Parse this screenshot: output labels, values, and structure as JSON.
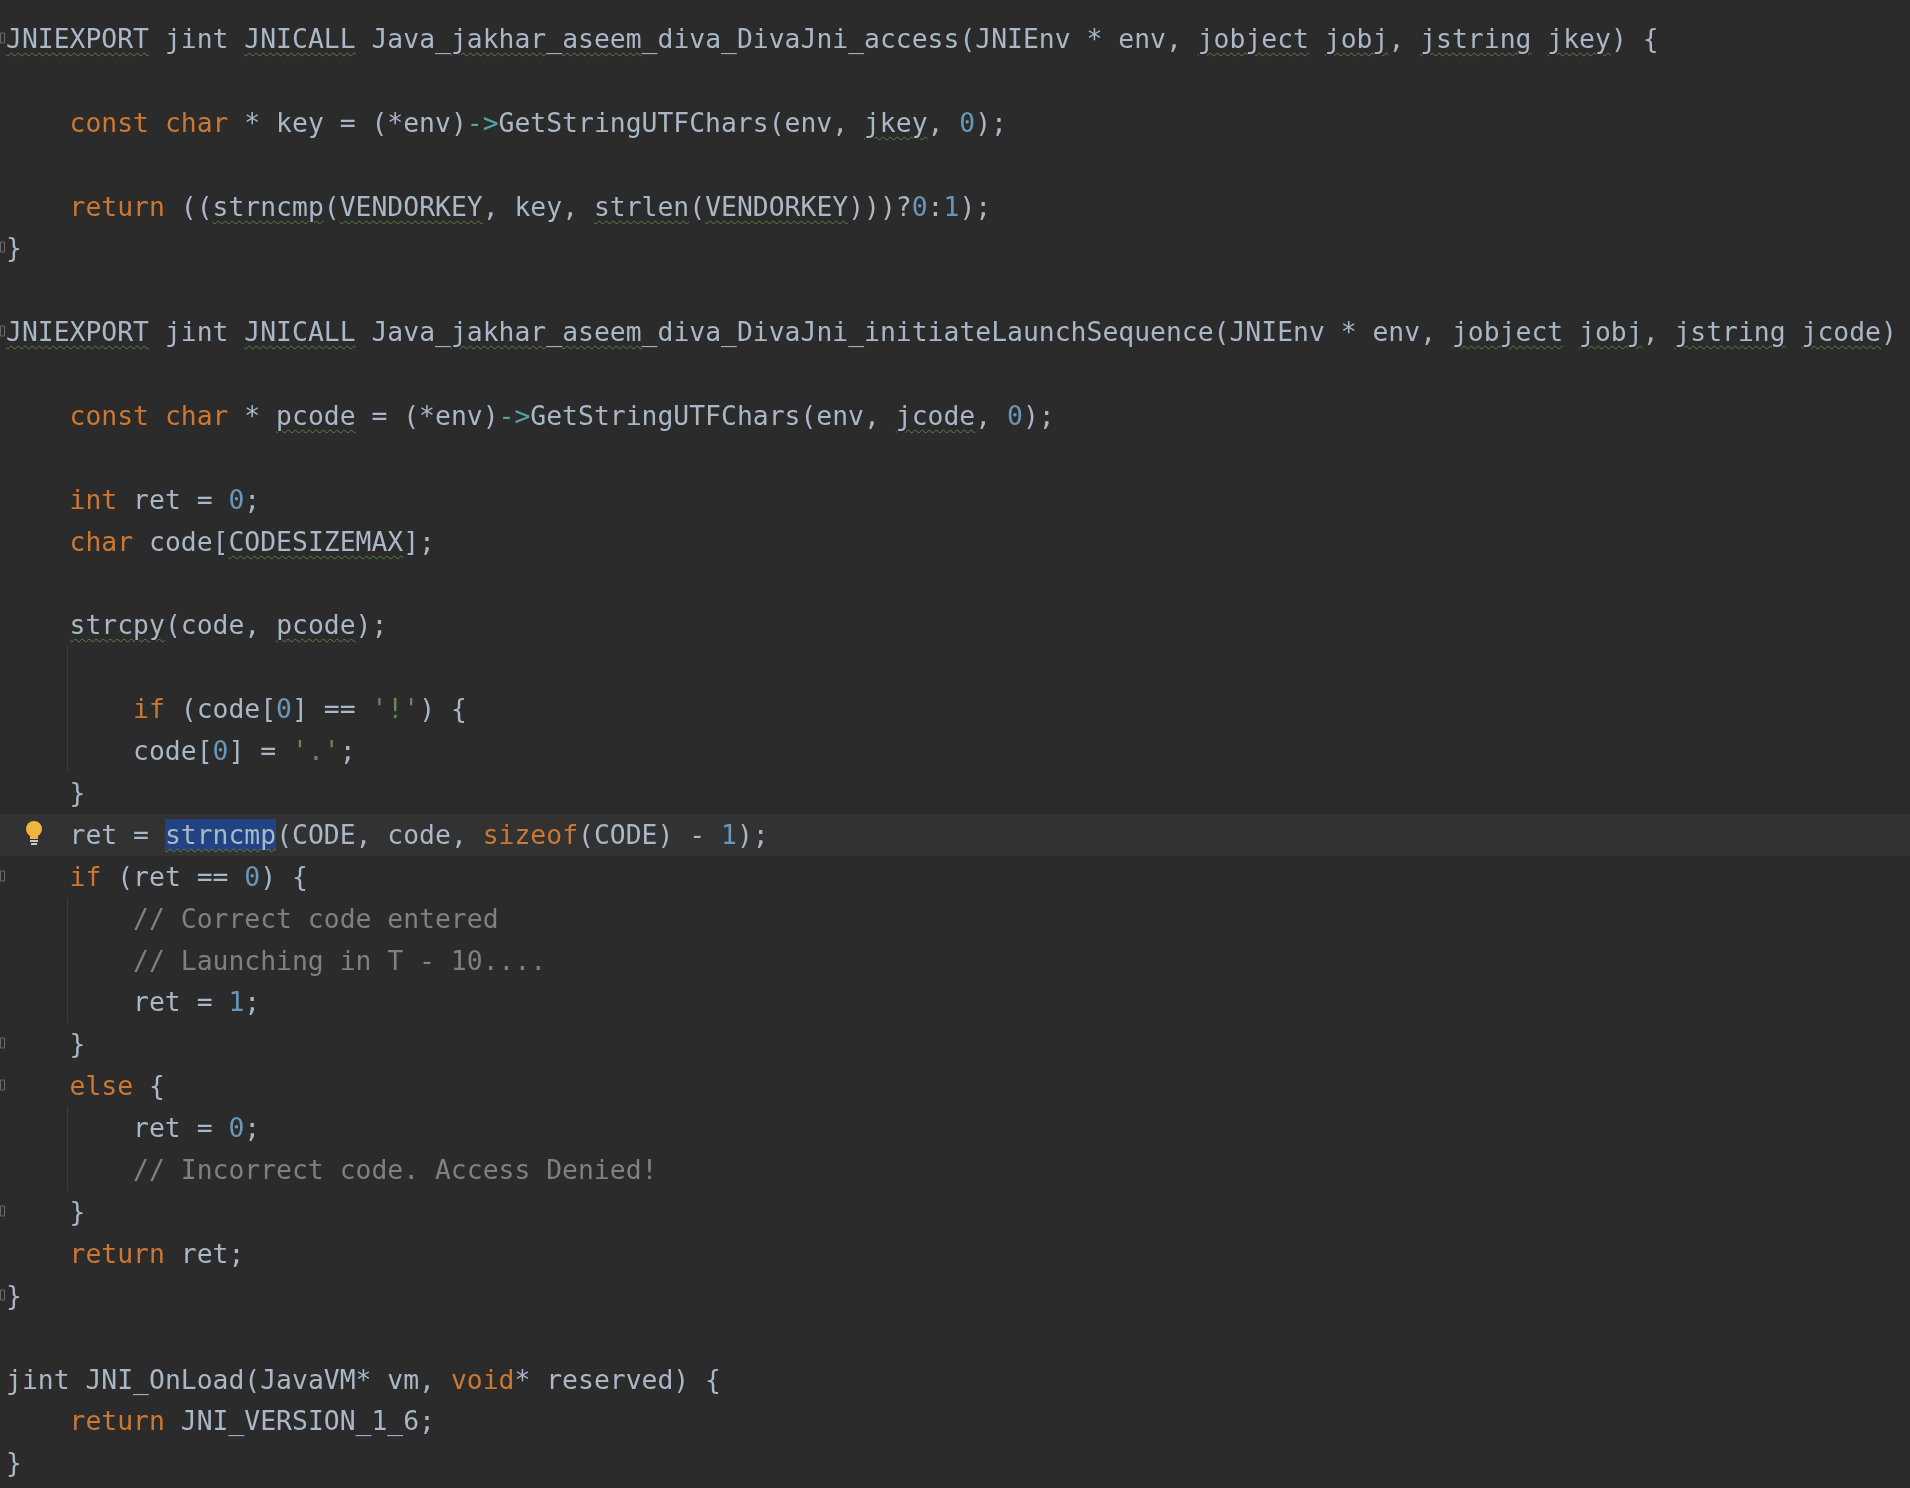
{
  "lines": [
    {
      "kind": "code",
      "fold": true,
      "current": false,
      "tokens": [
        {
          "text": "JNIEXPORT",
          "kind": "warn"
        },
        {
          "text": " jint ",
          "kind": "plain"
        },
        {
          "text": "JNICALL",
          "kind": "warn"
        },
        {
          "text": " Java_",
          "kind": "plain"
        },
        {
          "text": "jakhar",
          "kind": "warn"
        },
        {
          "text": "_",
          "kind": "plain"
        },
        {
          "text": "aseem",
          "kind": "warn"
        },
        {
          "text": "_diva_DivaJni_access(JNIEnv * env, ",
          "kind": "plain"
        },
        {
          "text": "jobject jobj",
          "kind": "warn"
        },
        {
          "text": ", ",
          "kind": "plain"
        },
        {
          "text": "jstring jkey",
          "kind": "warn"
        },
        {
          "text": ") {",
          "kind": "plain"
        }
      ],
      "children": [
        {
          "kind": "blank"
        },
        {
          "kind": "code",
          "fold": false,
          "current": false,
          "tokens": [
            {
              "text": "const char",
              "kind": "keyword"
            },
            {
              "text": " * key = (*env)",
              "kind": "plain"
            },
            {
              "text": "->",
              "kind": "arrow"
            },
            {
              "text": "GetStringUTFChars(env, ",
              "kind": "plain"
            },
            {
              "text": "jkey",
              "kind": "warn"
            },
            {
              "text": ", ",
              "kind": "plain"
            },
            {
              "text": "0",
              "kind": "number"
            },
            {
              "text": ");",
              "kind": "plain"
            }
          ]
        },
        {
          "kind": "blank"
        },
        {
          "kind": "code",
          "fold": false,
          "current": false,
          "tokens": [
            {
              "text": "return",
              "kind": "keyword"
            },
            {
              "text": " ((",
              "kind": "plain"
            },
            {
              "text": "strncmp",
              "kind": "warn"
            },
            {
              "text": "(",
              "kind": "plain"
            },
            {
              "text": "VENDORKEY",
              "kind": "warn"
            },
            {
              "text": ", key, ",
              "kind": "plain"
            },
            {
              "text": "strlen",
              "kind": "warn"
            },
            {
              "text": "(",
              "kind": "plain"
            },
            {
              "text": "VENDORKEY",
              "kind": "warn"
            },
            {
              "text": ")))?",
              "kind": "plain"
            },
            {
              "text": "0",
              "kind": "number"
            },
            {
              "text": ":",
              "kind": "plain"
            },
            {
              "text": "1",
              "kind": "number"
            },
            {
              "text": ");",
              "kind": "plain"
            }
          ]
        }
      ]
    },
    {
      "kind": "code",
      "fold": true,
      "current": false,
      "tokens": [
        {
          "text": "}",
          "kind": "plain"
        }
      ]
    },
    {
      "kind": "blank"
    },
    {
      "kind": "code",
      "fold": true,
      "current": false,
      "tokens": [
        {
          "text": "JNIEXPORT",
          "kind": "warn"
        },
        {
          "text": " jint ",
          "kind": "plain"
        },
        {
          "text": "JNICALL",
          "kind": "warn"
        },
        {
          "text": " Java_",
          "kind": "plain"
        },
        {
          "text": "jakhar",
          "kind": "warn"
        },
        {
          "text": "_",
          "kind": "plain"
        },
        {
          "text": "aseem",
          "kind": "warn"
        },
        {
          "text": "_diva_DivaJni_initiateLaunchSequence(JNIEnv * env, ",
          "kind": "plain"
        },
        {
          "text": "jobject jobj",
          "kind": "warn"
        },
        {
          "text": ", ",
          "kind": "plain"
        },
        {
          "text": "jstring jcode",
          "kind": "warn"
        },
        {
          "text": ")",
          "kind": "plain"
        }
      ],
      "children": [
        {
          "kind": "blank"
        },
        {
          "kind": "code",
          "fold": false,
          "current": false,
          "tokens": [
            {
              "text": "const char",
              "kind": "keyword"
            },
            {
              "text": " * ",
              "kind": "plain"
            },
            {
              "text": "pcode",
              "kind": "warn"
            },
            {
              "text": " = (*env)",
              "kind": "plain"
            },
            {
              "text": "->",
              "kind": "arrow"
            },
            {
              "text": "GetStringUTFChars(env, ",
              "kind": "plain"
            },
            {
              "text": "jcode",
              "kind": "warn"
            },
            {
              "text": ", ",
              "kind": "plain"
            },
            {
              "text": "0",
              "kind": "number"
            },
            {
              "text": ");",
              "kind": "plain"
            }
          ]
        },
        {
          "kind": "blank"
        },
        {
          "kind": "code",
          "fold": false,
          "current": false,
          "tokens": [
            {
              "text": "int",
              "kind": "keyword"
            },
            {
              "text": " ret = ",
              "kind": "plain"
            },
            {
              "text": "0",
              "kind": "number"
            },
            {
              "text": ";",
              "kind": "plain"
            }
          ]
        },
        {
          "kind": "code",
          "fold": false,
          "current": false,
          "tokens": [
            {
              "text": "char",
              "kind": "keyword"
            },
            {
              "text": " code[",
              "kind": "plain"
            },
            {
              "text": "CODESIZEMAX",
              "kind": "warn"
            },
            {
              "text": "];",
              "kind": "plain"
            }
          ]
        },
        {
          "kind": "blank"
        },
        {
          "kind": "code",
          "fold": false,
          "current": false,
          "tokens": [
            {
              "text": "strcpy",
              "kind": "warn"
            },
            {
              "text": "(code, ",
              "kind": "plain"
            },
            {
              "text": "pcode",
              "kind": "warn"
            },
            {
              "text": ");",
              "kind": "plain"
            }
          ],
          "children": [
            {
              "kind": "blank"
            },
            {
              "kind": "code",
              "fold": false,
              "current": false,
              "tokens": [
                {
                  "text": "if",
                  "kind": "keyword"
                },
                {
                  "text": " (code[",
                  "kind": "plain"
                },
                {
                  "text": "0",
                  "kind": "number"
                },
                {
                  "text": "] == ",
                  "kind": "plain"
                },
                {
                  "text": "'!'",
                  "kind": "string"
                },
                {
                  "text": ") {",
                  "kind": "plain"
                }
              ]
            },
            {
              "kind": "code",
              "fold": false,
              "current": false,
              "tokens": [
                {
                  "text": "code[",
                  "kind": "plain"
                },
                {
                  "text": "0",
                  "kind": "number"
                },
                {
                  "text": "] = ",
                  "kind": "plain"
                },
                {
                  "text": "'.'",
                  "kind": "string"
                },
                {
                  "text": ";",
                  "kind": "plain"
                }
              ]
            }
          ]
        },
        {
          "kind": "code",
          "fold": false,
          "current": false,
          "tokens": [
            {
              "text": "}",
              "kind": "plain"
            }
          ]
        },
        {
          "kind": "code",
          "fold": false,
          "current": true,
          "tokens": [
            {
              "text": "ret = ",
              "kind": "plain"
            },
            {
              "text": "strncmp",
              "kind": "selected"
            },
            {
              "text": "(CODE, code, ",
              "kind": "plain"
            },
            {
              "text": "sizeof",
              "kind": "keyword"
            },
            {
              "text": "(CODE) - ",
              "kind": "plain"
            },
            {
              "text": "1",
              "kind": "number"
            },
            {
              "text": ");",
              "kind": "plain"
            }
          ]
        },
        {
          "kind": "code",
          "fold": true,
          "current": false,
          "tokens": [
            {
              "text": "if",
              "kind": "keyword"
            },
            {
              "text": " (ret == ",
              "kind": "plain"
            },
            {
              "text": "0",
              "kind": "number"
            },
            {
              "text": ") {",
              "kind": "plain"
            }
          ],
          "children": [
            {
              "kind": "code",
              "fold": false,
              "current": false,
              "tokens": [
                {
                  "text": "// Correct code entered",
                  "kind": "comment"
                }
              ]
            },
            {
              "kind": "code",
              "fold": false,
              "current": false,
              "tokens": [
                {
                  "text": "// Launching in T - 10....",
                  "kind": "comment"
                }
              ]
            },
            {
              "kind": "code",
              "fold": false,
              "current": false,
              "tokens": [
                {
                  "text": "ret = ",
                  "kind": "plain"
                },
                {
                  "text": "1",
                  "kind": "number"
                },
                {
                  "text": ";",
                  "kind": "plain"
                }
              ]
            }
          ]
        },
        {
          "kind": "code",
          "fold": true,
          "current": false,
          "tokens": [
            {
              "text": "}",
              "kind": "plain"
            }
          ]
        },
        {
          "kind": "code",
          "fold": true,
          "current": false,
          "tokens": [
            {
              "text": "else",
              "kind": "keyword"
            },
            {
              "text": " {",
              "kind": "plain"
            }
          ],
          "children": [
            {
              "kind": "code",
              "fold": false,
              "current": false,
              "tokens": [
                {
                  "text": "ret = ",
                  "kind": "plain"
                },
                {
                  "text": "0",
                  "kind": "number"
                },
                {
                  "text": ";",
                  "kind": "plain"
                }
              ]
            },
            {
              "kind": "code",
              "fold": false,
              "current": false,
              "tokens": [
                {
                  "text": "// Incorrect code. Access Denied!",
                  "kind": "comment"
                }
              ]
            }
          ]
        },
        {
          "kind": "code",
          "fold": true,
          "current": false,
          "tokens": [
            {
              "text": "}",
              "kind": "plain"
            }
          ]
        },
        {
          "kind": "code",
          "fold": false,
          "current": false,
          "tokens": [
            {
              "text": "return",
              "kind": "keyword"
            },
            {
              "text": " ret;",
              "kind": "plain"
            }
          ]
        }
      ]
    },
    {
      "kind": "code",
      "fold": true,
      "current": false,
      "tokens": [
        {
          "text": "}",
          "kind": "plain"
        }
      ]
    },
    {
      "kind": "blank"
    },
    {
      "kind": "code",
      "fold": false,
      "current": false,
      "tokens": [
        {
          "text": "jint JNI_OnLoad(JavaVM* vm, ",
          "kind": "plain"
        },
        {
          "text": "void",
          "kind": "keyword"
        },
        {
          "text": "* reserved) {",
          "kind": "plain"
        }
      ],
      "children": [
        {
          "kind": "code",
          "fold": false,
          "current": false,
          "tokens": [
            {
              "text": "return",
              "kind": "keyword"
            },
            {
              "text": " JNI_VERSION_1_6;",
              "kind": "plain"
            }
          ]
        }
      ]
    },
    {
      "kind": "code",
      "fold": false,
      "current": false,
      "tokens": [
        {
          "text": "}",
          "kind": "plain"
        }
      ]
    }
  ]
}
